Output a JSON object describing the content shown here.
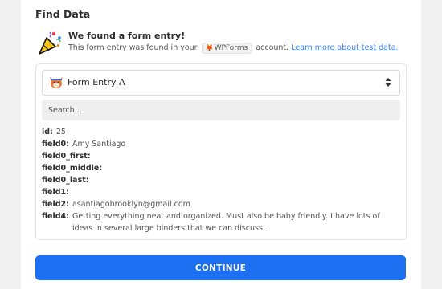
{
  "section_title": "Find Data",
  "found": {
    "title": "We found a form entry!",
    "desc_prefix": "This form entry was found in your",
    "app_badge": "WPForms",
    "desc_suffix": "account.",
    "learn_more": "Learn more about test data."
  },
  "entry_select": {
    "selected": "Form Entry A"
  },
  "search": {
    "placeholder": "Search..."
  },
  "fields": [
    {
      "name": "id:",
      "value": "25"
    },
    {
      "name": "field0:",
      "value": "Amy Santiago"
    },
    {
      "name": "field0_first:",
      "value": ""
    },
    {
      "name": "field0_middle:",
      "value": ""
    },
    {
      "name": "field0_last:",
      "value": ""
    },
    {
      "name": "field1:",
      "value": ""
    },
    {
      "name": "field2:",
      "value": "asantiagobrooklyn@gmail.com"
    },
    {
      "name": "field4:",
      "value": "Getting everything neat and organized. Must also be baby friendly. I have lots of ideas in several large binders that we can discuss."
    }
  ],
  "continue_label": "CONTINUE",
  "colors": {
    "primary": "#1d6ff2",
    "link": "#3d7ff0",
    "background": "#f0f0f0"
  },
  "icons": [
    "party-popper-icon",
    "wpforms-fox-icon",
    "chevron-updown-icon"
  ]
}
